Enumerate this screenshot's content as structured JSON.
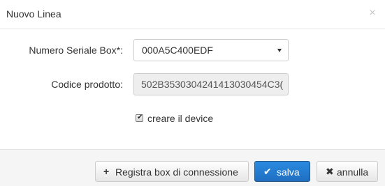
{
  "dialog": {
    "title": "Nuovo Linea",
    "close_symbol": "×"
  },
  "form": {
    "serial_box": {
      "label": "Numero Seriale Box*:",
      "value": "000A5C400EDF"
    },
    "product_code": {
      "label": "Codice prodotto:",
      "value": "502B3530304241413030454C3("
    },
    "create_device": {
      "label": "creare il device",
      "checked": true,
      "mark": "✔"
    }
  },
  "footer": {
    "register_button": {
      "icon": "plus-icon",
      "icon_glyph": "+",
      "label": "Registra box di connessione"
    },
    "save_button": {
      "icon": "check-icon",
      "icon_glyph": "✔",
      "label": "salva",
      "color": "#1f75cc"
    },
    "cancel_button": {
      "icon": "times-icon",
      "icon_glyph": "✖",
      "label": "annulla"
    }
  }
}
